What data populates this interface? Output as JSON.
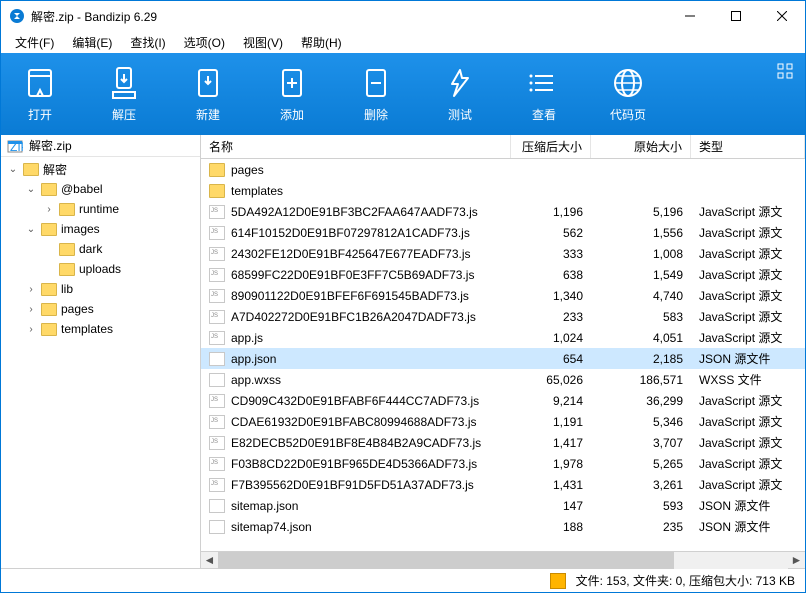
{
  "window": {
    "title": "解密.zip - Bandizip 6.29"
  },
  "menu": [
    "文件(F)",
    "编辑(E)",
    "查找(I)",
    "选项(O)",
    "视图(V)",
    "帮助(H)"
  ],
  "toolbar": [
    {
      "id": "open",
      "label": "打开"
    },
    {
      "id": "extract",
      "label": "解压"
    },
    {
      "id": "new",
      "label": "新建"
    },
    {
      "id": "add",
      "label": "添加"
    },
    {
      "id": "delete",
      "label": "删除"
    },
    {
      "id": "test",
      "label": "测试"
    },
    {
      "id": "view",
      "label": "查看"
    },
    {
      "id": "codepage",
      "label": "代码页"
    }
  ],
  "archive_name": "解密.zip",
  "tree": [
    {
      "depth": 0,
      "exp": "down",
      "label": "解密"
    },
    {
      "depth": 1,
      "exp": "down",
      "label": "@babel"
    },
    {
      "depth": 2,
      "exp": "right",
      "label": "runtime"
    },
    {
      "depth": 1,
      "exp": "down",
      "label": "images"
    },
    {
      "depth": 2,
      "exp": "",
      "label": "dark"
    },
    {
      "depth": 2,
      "exp": "",
      "label": "uploads"
    },
    {
      "depth": 1,
      "exp": "right",
      "label": "lib"
    },
    {
      "depth": 1,
      "exp": "right",
      "label": "pages"
    },
    {
      "depth": 1,
      "exp": "right",
      "label": "templates"
    }
  ],
  "columns": {
    "name": "名称",
    "comp": "压缩后大小",
    "orig": "原始大小",
    "type": "类型"
  },
  "files": [
    {
      "icon": "folder",
      "name": "pages",
      "comp": "",
      "orig": "",
      "type": ""
    },
    {
      "icon": "folder",
      "name": "templates",
      "comp": "",
      "orig": "",
      "type": ""
    },
    {
      "icon": "js",
      "name": "5DA492A12D0E91BF3BC2FAA647AADF73.js",
      "comp": "1,196",
      "orig": "5,196",
      "type": "JavaScript 源文"
    },
    {
      "icon": "js",
      "name": "614F10152D0E91BF07297812A1CADF73.js",
      "comp": "562",
      "orig": "1,556",
      "type": "JavaScript 源文"
    },
    {
      "icon": "js",
      "name": "24302FE12D0E91BF425647E677EADF73.js",
      "comp": "333",
      "orig": "1,008",
      "type": "JavaScript 源文"
    },
    {
      "icon": "js",
      "name": "68599FC22D0E91BF0E3FF7C5B69ADF73.js",
      "comp": "638",
      "orig": "1,549",
      "type": "JavaScript 源文"
    },
    {
      "icon": "js",
      "name": "890901122D0E91BFEF6F691545BADF73.js",
      "comp": "1,340",
      "orig": "4,740",
      "type": "JavaScript 源文"
    },
    {
      "icon": "js",
      "name": "A7D402272D0E91BFC1B26A2047DADF73.js",
      "comp": "233",
      "orig": "583",
      "type": "JavaScript 源文"
    },
    {
      "icon": "js",
      "name": "app.js",
      "comp": "1,024",
      "orig": "4,051",
      "type": "JavaScript 源文"
    },
    {
      "icon": "json",
      "name": "app.json",
      "comp": "654",
      "orig": "2,185",
      "type": "JSON 源文件",
      "selected": true
    },
    {
      "icon": "file",
      "name": "app.wxss",
      "comp": "65,026",
      "orig": "186,571",
      "type": "WXSS 文件"
    },
    {
      "icon": "js",
      "name": "CD909C432D0E91BFABF6F444CC7ADF73.js",
      "comp": "9,214",
      "orig": "36,299",
      "type": "JavaScript 源文"
    },
    {
      "icon": "js",
      "name": "CDAE61932D0E91BFABC80994688ADF73.js",
      "comp": "1,191",
      "orig": "5,346",
      "type": "JavaScript 源文"
    },
    {
      "icon": "js",
      "name": "E82DECB52D0E91BF8E4B84B2A9CADF73.js",
      "comp": "1,417",
      "orig": "3,707",
      "type": "JavaScript 源文"
    },
    {
      "icon": "js",
      "name": "F03B8CD22D0E91BF965DE4D5366ADF73.js",
      "comp": "1,978",
      "orig": "5,265",
      "type": "JavaScript 源文"
    },
    {
      "icon": "js",
      "name": "F7B395562D0E91BF91D5FD51A37ADF73.js",
      "comp": "1,431",
      "orig": "3,261",
      "type": "JavaScript 源文"
    },
    {
      "icon": "json",
      "name": "sitemap.json",
      "comp": "147",
      "orig": "593",
      "type": "JSON 源文件"
    },
    {
      "icon": "json",
      "name": "sitemap74.json",
      "comp": "188",
      "orig": "235",
      "type": "JSON 源文件"
    }
  ],
  "status": "文件: 153, 文件夹: 0, 压缩包大小: 713 KB"
}
